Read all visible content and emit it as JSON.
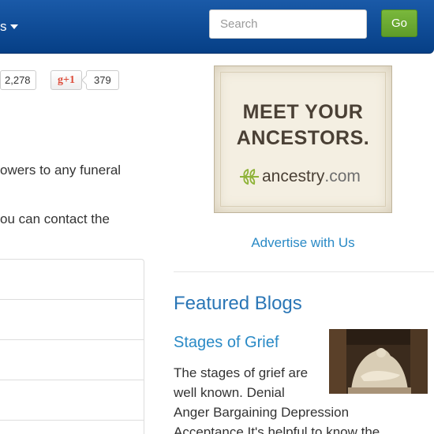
{
  "navbar": {
    "dropdown_label": "s",
    "search_placeholder": "Search",
    "go_label": "Go"
  },
  "social": {
    "share_count": "2,278",
    "gplus_label": "g+1",
    "gplus_count": "379"
  },
  "main": {
    "text_line1": "owers to any funeral",
    "text_line2": "ou can contact the"
  },
  "ad": {
    "headline_line1": "MEET YOUR",
    "headline_line2": "ANCESTORS.",
    "brand_name": "ancestry",
    "brand_tld": ".com",
    "advertise_link": "Advertise with Us"
  },
  "featured": {
    "section_title": "Featured Blogs",
    "blog_title": "Stages of Grief",
    "excerpt_line1": "The stages of grief are",
    "excerpt_line2": "well known. Denial",
    "excerpt_line3": "Anger Bargaining Depression",
    "excerpt_line4": "Acceptance It's helpful to know the"
  },
  "icons": {
    "caret": "chevron-down-icon",
    "leaf": "leaf-icon"
  },
  "colors": {
    "navbar": "#0d4e9b",
    "go_button": "#6aab31",
    "link": "#2a8ac6",
    "heading": "#2a76b6"
  }
}
